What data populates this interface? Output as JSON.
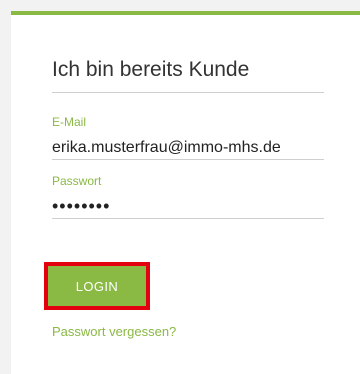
{
  "login_card": {
    "title": "Ich bin bereits Kunde",
    "email": {
      "label": "E-Mail",
      "value": "erika.musterfrau@immo-mhs.de"
    },
    "password": {
      "label": "Passwort",
      "value": "••••••••"
    },
    "login_button_label": "LOGIN",
    "forgot_password_link": "Passwort vergessen?"
  },
  "colors": {
    "accent": "#8ab944",
    "highlight_border": "#e3000f",
    "text": "#333333",
    "divider": "#cfcfcf"
  }
}
